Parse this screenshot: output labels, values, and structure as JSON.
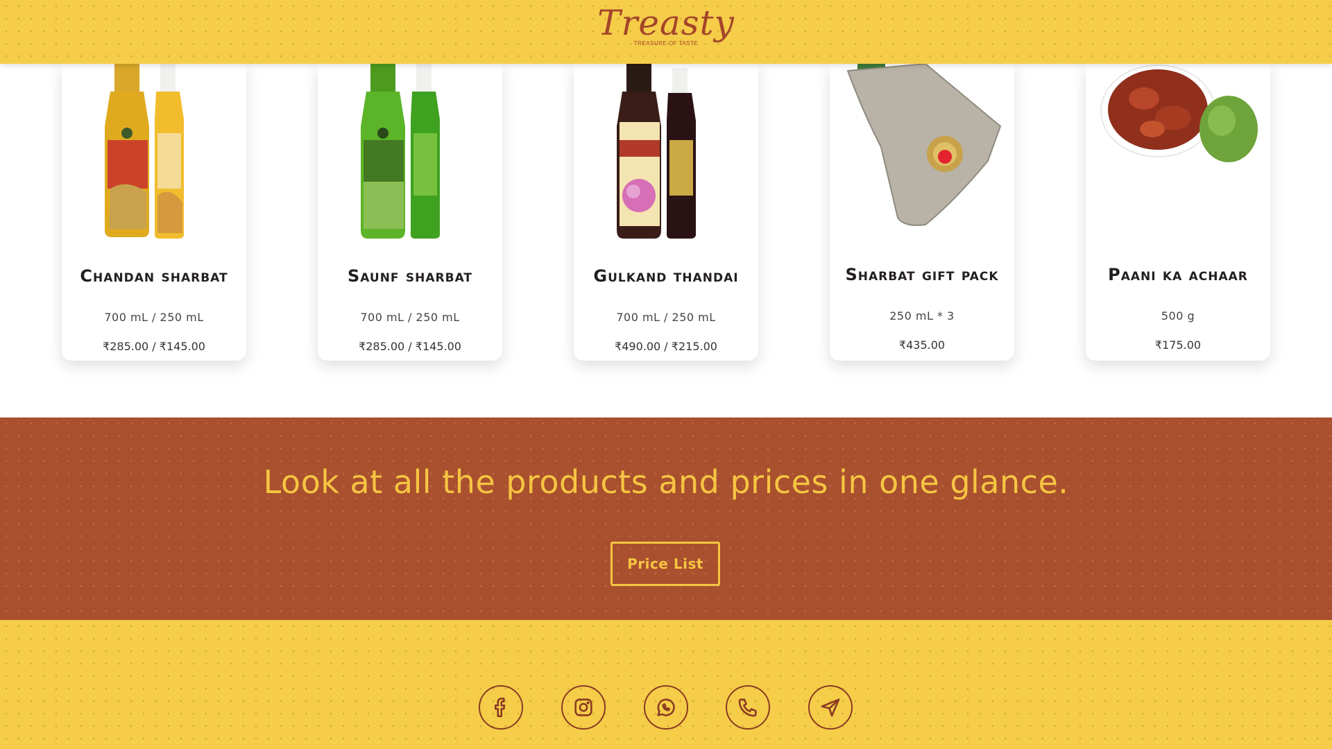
{
  "header": {
    "logo_text": "Treasty",
    "tagline": "TREASURE OF TASTE"
  },
  "products": [
    {
      "name": "Chandan sharbat",
      "size": "700 mL / 250 mL",
      "price": "₹285.00 / ₹145.00"
    },
    {
      "name": "Saunf sharbat",
      "size": "700 mL / 250 mL",
      "price": "₹285.00 / ₹145.00"
    },
    {
      "name": "Gulkand thandai",
      "size": "700 mL / 250 mL",
      "price": "₹490.00 / ₹215.00"
    },
    {
      "name": "Sharbat gift pack",
      "size": "250 mL * 3",
      "price": "₹435.00"
    },
    {
      "name": "Paani ka achaar",
      "size": "500 g",
      "price": "₹175.00"
    }
  ],
  "banner": {
    "heading": "Look at all the products and prices in one glance.",
    "button_label": "Price List"
  },
  "footer": {
    "social_icons": [
      "facebook-icon",
      "instagram-icon",
      "whatsapp-icon",
      "phone-icon",
      "send-icon"
    ]
  },
  "colors": {
    "header_bg": "#f5cd49",
    "brand_brown": "#a3452a",
    "banner_bg": "#a9502e",
    "accent_yellow": "#f6c542"
  }
}
